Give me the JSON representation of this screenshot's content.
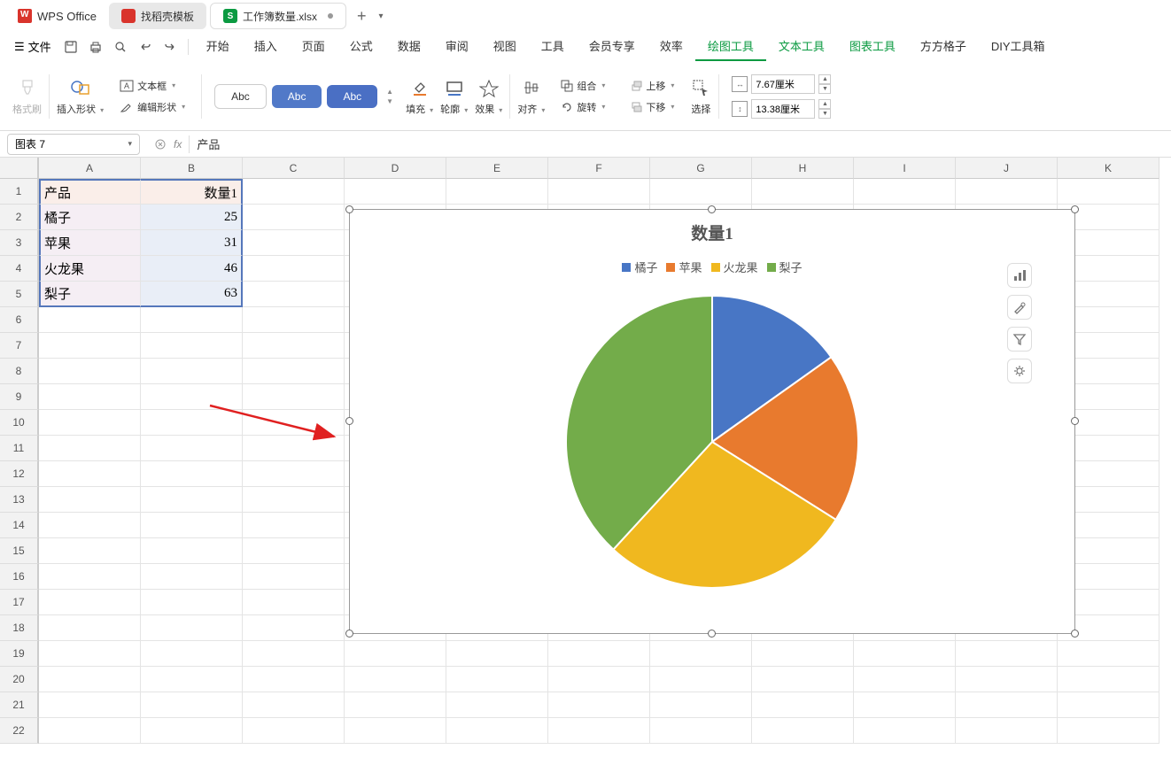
{
  "app_brand": "WPS Office",
  "tabs": {
    "inactive1": "找稻壳模板",
    "active": "工作簿数量.xlsx"
  },
  "file_menu": "文件",
  "menu": [
    "开始",
    "插入",
    "页面",
    "公式",
    "数据",
    "审阅",
    "视图",
    "工具",
    "会员专享",
    "效率",
    "绘图工具",
    "文本工具",
    "图表工具",
    "方方格子",
    "DIY工具箱"
  ],
  "active_menu_index": 10,
  "green_menu_indices": [
    11,
    12
  ],
  "ribbon": {
    "format_brush": "格式刷",
    "insert_shape": "插入形状",
    "text_box": "文本框",
    "edit_shape": "编辑形状",
    "abc": "Abc",
    "fill": "填充",
    "outline": "轮廓",
    "effect": "效果",
    "align": "对齐",
    "group": "组合",
    "rotate": "旋转",
    "move_up": "上移",
    "move_down": "下移",
    "select": "选择",
    "width": "7.67厘米",
    "height": "13.38厘米"
  },
  "name_box": "图表 7",
  "formula_text": "产品",
  "columns": [
    "A",
    "B",
    "C",
    "D",
    "E",
    "F",
    "G",
    "H",
    "I",
    "J",
    "K"
  ],
  "rows": [
    "1",
    "2",
    "3",
    "4",
    "5",
    "6",
    "7",
    "8",
    "9",
    "10",
    "11",
    "12",
    "13",
    "14",
    "15",
    "16",
    "17",
    "18",
    "19",
    "20",
    "21",
    "22"
  ],
  "cells": {
    "A1": "产品",
    "B1": "数量1",
    "A2": "橘子",
    "B2": "25",
    "A3": "苹果",
    "B3": "31",
    "A4": "火龙果",
    "B4": "46",
    "A5": "梨子",
    "B5": "63"
  },
  "chart_data": {
    "type": "pie",
    "title": "数量1",
    "categories": [
      "橘子",
      "苹果",
      "火龙果",
      "梨子"
    ],
    "values": [
      25,
      31,
      46,
      63
    ],
    "colors": [
      "#4876c5",
      "#e87a2e",
      "#f0b81f",
      "#73ac4a"
    ]
  }
}
